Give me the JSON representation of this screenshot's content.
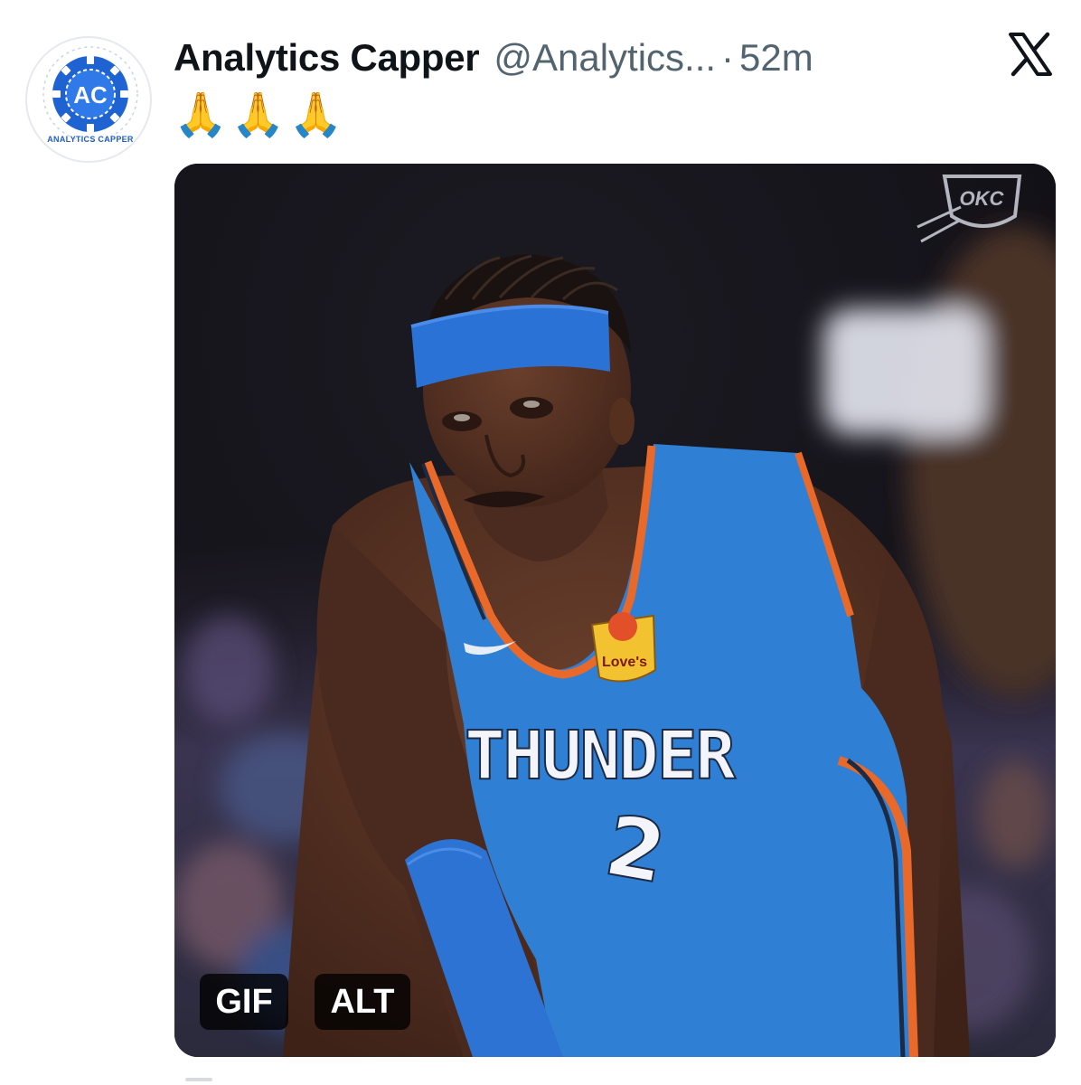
{
  "author": {
    "display_name": "Analytics Capper",
    "handle": "@Analytics...",
    "separator": "·",
    "time_ago": "52m",
    "avatar": {
      "initials": "AC",
      "caption": "ANALYTICS CAPPER",
      "icon": "poker-chip-logo"
    }
  },
  "tweet": {
    "text": "🙏🙏🙏"
  },
  "media": {
    "type": "gif",
    "badges": {
      "gif_label": "GIF",
      "alt_label": "ALT"
    },
    "jersey": {
      "team_text": "THUNDER",
      "number": "2",
      "patch": "Love's",
      "corner_logo": "OKC"
    }
  },
  "platform": {
    "logo": "x-logo"
  },
  "colors": {
    "jersey_blue": "#2f7fd4",
    "trim_orange": "#e8692a",
    "brand_blue": "#1f5fc4",
    "muted_text": "#536471"
  }
}
